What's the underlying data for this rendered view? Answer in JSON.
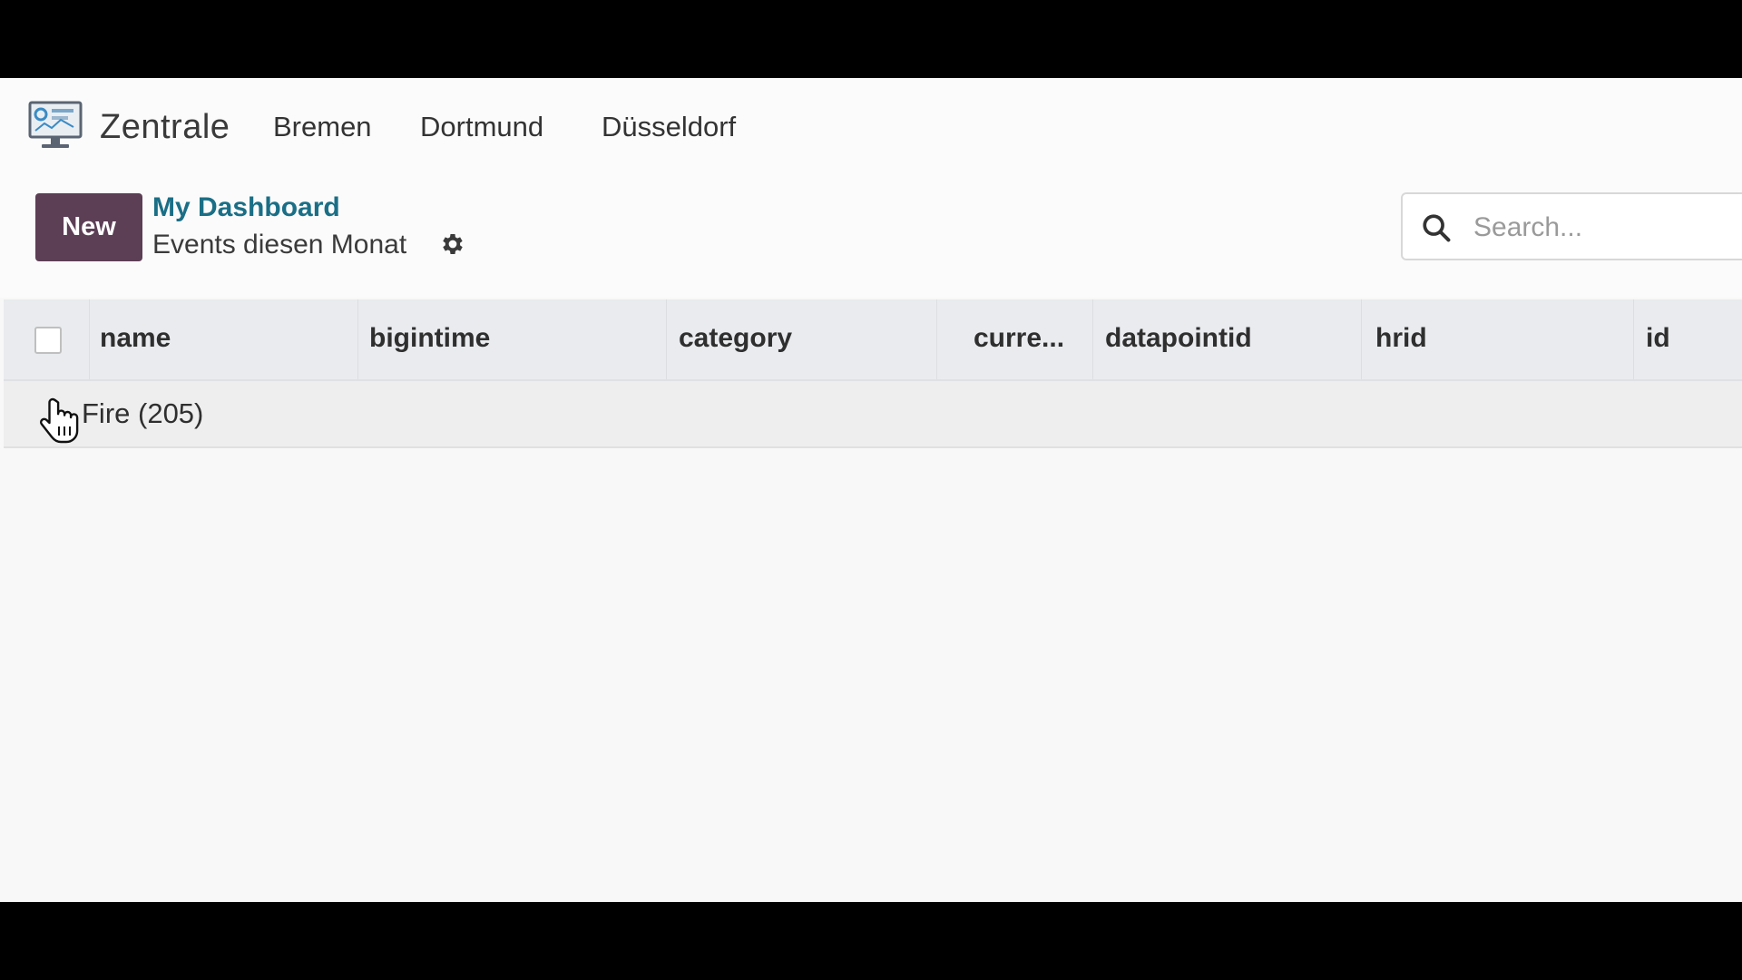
{
  "app": {
    "name": "Zentrale",
    "nav": [
      "Bremen",
      "Dortmund",
      "Düsseldorf"
    ]
  },
  "control": {
    "new_label": "New",
    "breadcrumb": "My Dashboard",
    "subtitle": "Events diesen Monat"
  },
  "search": {
    "placeholder": "Search..."
  },
  "table": {
    "columns": [
      "name",
      "bigintime",
      "category",
      "curre...",
      "datapointid",
      "hrid",
      "id"
    ],
    "groups": [
      {
        "label": "Fire (205)"
      }
    ]
  },
  "colors": {
    "accent": "#5c3e55",
    "link": "#1a6f86",
    "header_bg": "#e9ebee"
  },
  "icons": [
    "dashboard-monitor-icon",
    "gear-icon",
    "search-icon",
    "hand-pointer-icon"
  ]
}
